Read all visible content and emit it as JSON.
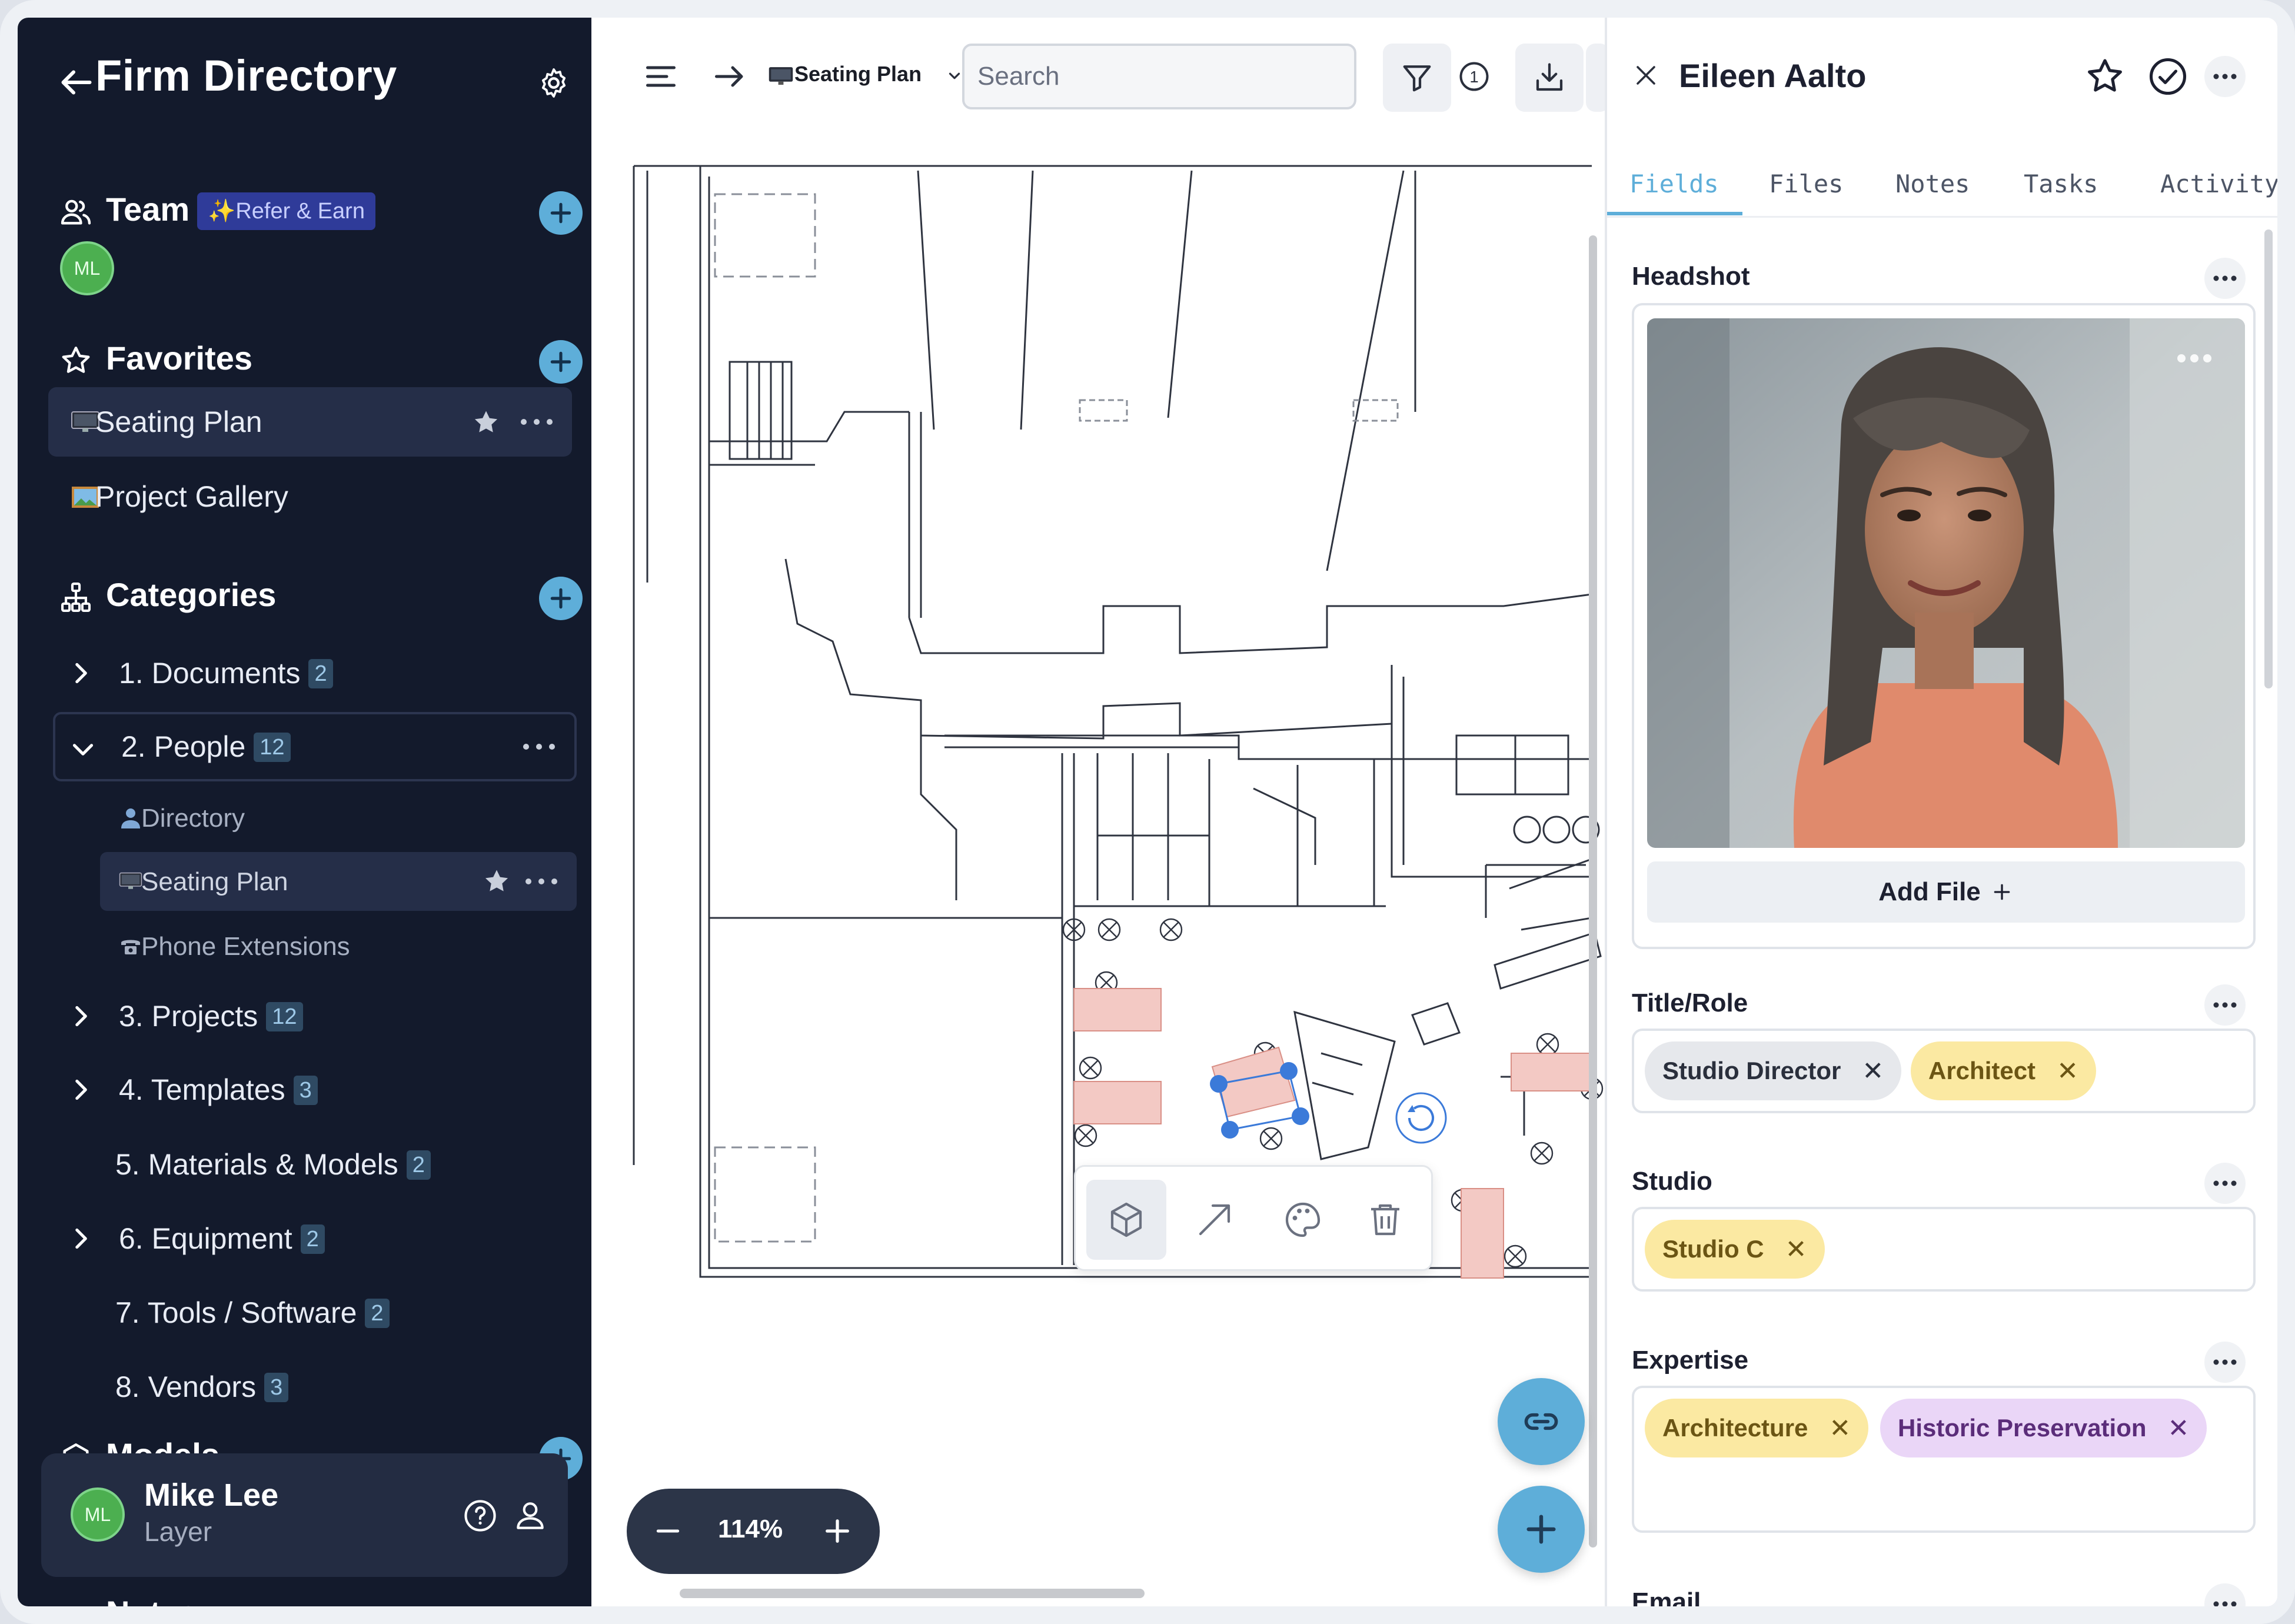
{
  "sidebar": {
    "title": "Firm Directory",
    "team": {
      "label": "Team",
      "badge": "✨Refer & Earn",
      "avatar": "ML"
    },
    "favorites": {
      "label": "Favorites",
      "items": [
        {
          "emoji": "desktop",
          "label": "Seating Plan"
        },
        {
          "emoji": "picture",
          "label": "Project Gallery"
        }
      ]
    },
    "categories": {
      "label": "Categories",
      "items": [
        {
          "label": "1. Documents",
          "count": "2"
        },
        {
          "label": "2. People",
          "count": "12"
        },
        {
          "label": "3. Projects",
          "count": "12"
        },
        {
          "label": "4. Templates",
          "count": "3"
        },
        {
          "label": "5. Materials & Models",
          "count": "2"
        },
        {
          "label": "6. Equipment",
          "count": "2"
        },
        {
          "label": "7. Tools / Software",
          "count": "2"
        },
        {
          "label": "8. Vendors",
          "count": "3"
        }
      ],
      "people_children": [
        {
          "label": "Directory"
        },
        {
          "label": "Seating Plan"
        },
        {
          "label": "Phone Extensions"
        }
      ]
    },
    "models_label": "Models",
    "notes_label": "Notes",
    "user": {
      "avatar": "ML",
      "name": "Mike Lee",
      "subtitle": "Layer"
    }
  },
  "toolbar": {
    "breadcrumb": "Seating Plan",
    "search_placeholder": "Search",
    "filter_count": "1"
  },
  "canvas": {
    "zoom": "114%"
  },
  "panel": {
    "name": "Eileen Aalto",
    "tabs": [
      "Fields",
      "Files",
      "Notes",
      "Tasks",
      "Activity"
    ],
    "active_tab": "Fields",
    "headshot": {
      "label": "Headshot",
      "add_file": "Add File"
    },
    "title_role": {
      "label": "Title/Role",
      "tags": [
        "Studio Director",
        "Architect"
      ]
    },
    "studio": {
      "label": "Studio",
      "tags": [
        "Studio C"
      ]
    },
    "expertise": {
      "label": "Expertise",
      "tags": [
        "Architecture",
        "Historic Preservation"
      ]
    },
    "email": {
      "label": "Email"
    }
  },
  "colors": {
    "sidebar_bg": "#131a2c",
    "accent": "#5eaed9",
    "tag_grey": "#e6e8ec",
    "tag_yellow": "#fbe9a2",
    "tag_purple": "#ead6f7",
    "desk_pink": "#f3c9c4",
    "selection_blue": "#3b7ad9"
  }
}
